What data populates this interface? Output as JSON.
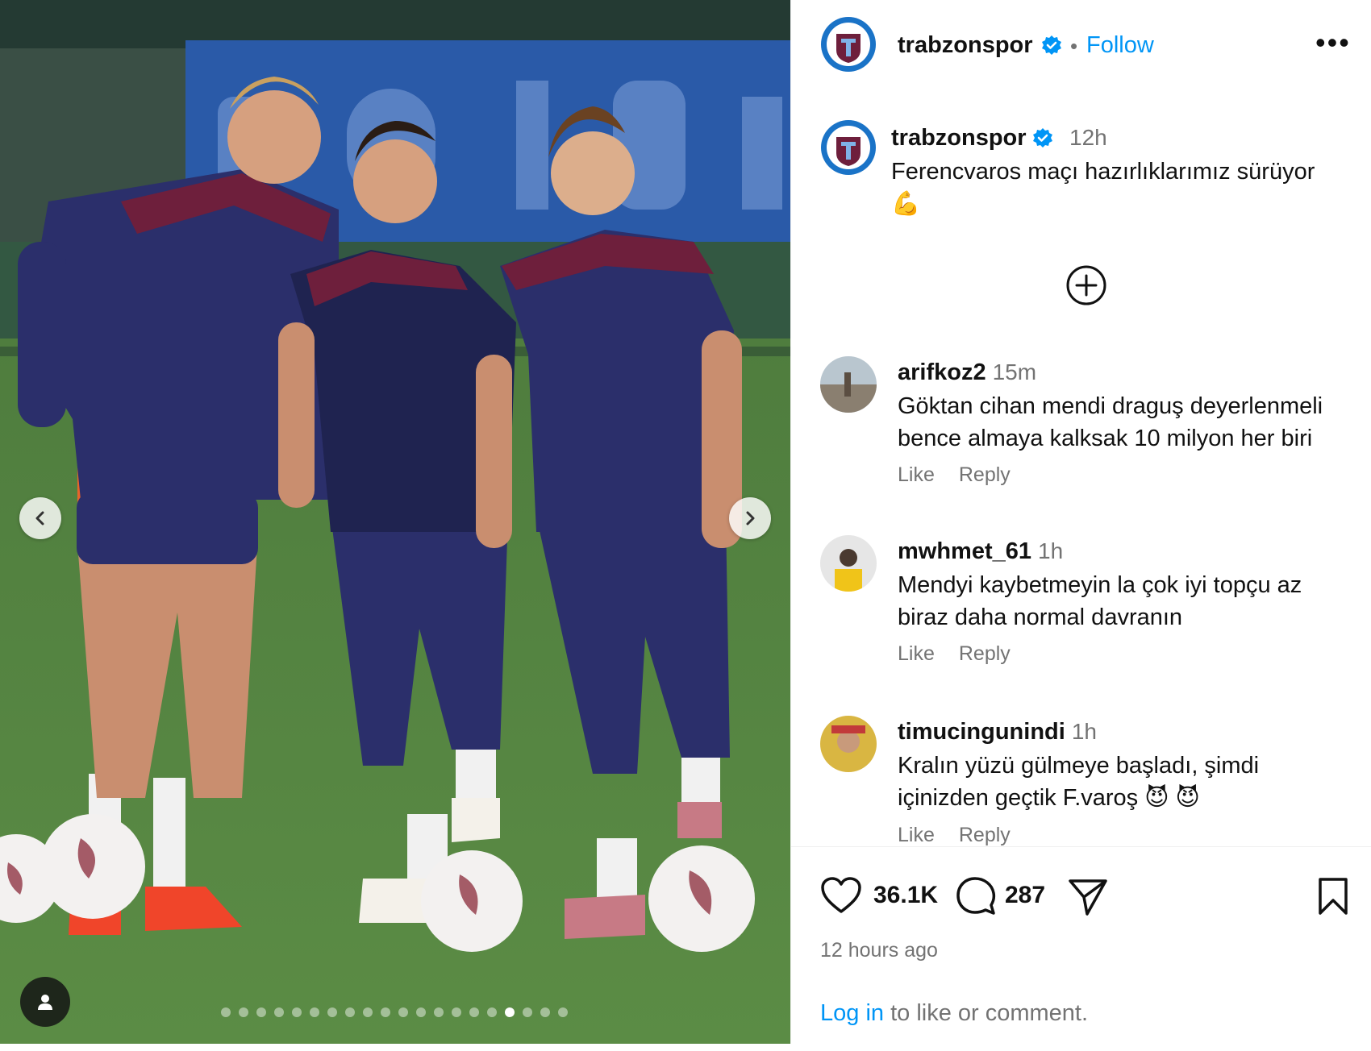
{
  "post": {
    "account": "trabzonspor",
    "follow_label": "Follow",
    "separator": "•",
    "more_label": "•••",
    "caption_time": "12h",
    "caption_text": "Ferencvaros maçı hazırlıklarımız sürüyor 💪"
  },
  "comments": [
    {
      "username": "arifkoz2",
      "time": "15m",
      "text": "Göktan cihan mendi draguş deyerlenmeli bence almaya kalksak 10 milyon her biri",
      "like": "Like",
      "reply": "Reply"
    },
    {
      "username": "mwhmet_61",
      "time": "1h",
      "text": "Mendyi kaybetmeyin la çok iyi topçu az biraz daha normal davranın",
      "like": "Like",
      "reply": "Reply"
    },
    {
      "username": "timucingunindi",
      "time": "1h",
      "text": "Kralın yüzü gülmeye başladı, şimdi içinizden geçtik F.varoş 😈 😈",
      "like": "Like",
      "reply": "Reply"
    }
  ],
  "stats": {
    "likes": "36.1K",
    "comments": "287",
    "posted": "12 hours ago"
  },
  "login": {
    "link": "Log in",
    "rest": " to like or comment."
  },
  "carousel": {
    "total": 20,
    "active_index": 16
  },
  "colors": {
    "link_blue": "#0095f6",
    "muted": "#737373",
    "kit_navy": "#2b2f6b",
    "kit_maroon": "#6e1f3c",
    "verified": "#0095f6"
  },
  "icons": [
    "chevron-left-icon",
    "chevron-right-icon",
    "user-tag-icon",
    "verified-badge-icon",
    "more-icon",
    "add-circle-icon",
    "heart-icon",
    "comment-icon",
    "share-icon",
    "bookmark-icon"
  ]
}
